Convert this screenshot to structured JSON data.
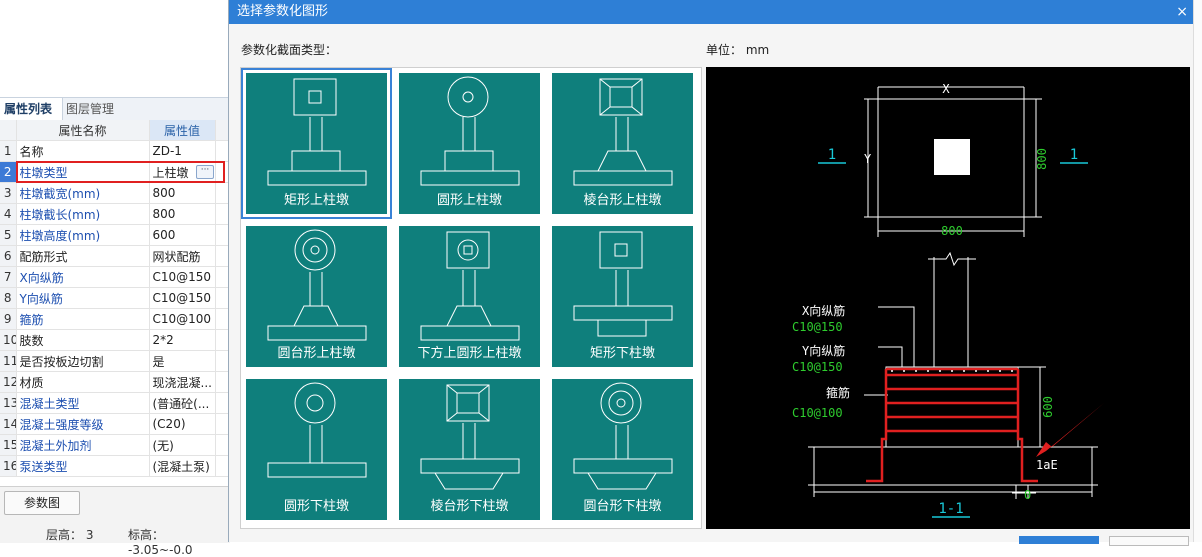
{
  "left_panel": {
    "tabs": [
      "属性列表",
      "图层管理"
    ],
    "table_headers": [
      "属性名称",
      "属性值"
    ],
    "rows": [
      {
        "n": "1",
        "name": "名称",
        "value": "ZD-1"
      },
      {
        "n": "2",
        "name": "柱墩类型",
        "value": "上柱墩"
      },
      {
        "n": "3",
        "name": "柱墩截宽(mm)",
        "value": "800"
      },
      {
        "n": "4",
        "name": "柱墩截长(mm)",
        "value": "800"
      },
      {
        "n": "5",
        "name": "柱墩高度(mm)",
        "value": "600"
      },
      {
        "n": "6",
        "name": "配筋形式",
        "value": "网状配筋"
      },
      {
        "n": "7",
        "name": "X向纵筋",
        "value": "C10@150"
      },
      {
        "n": "8",
        "name": "Y向纵筋",
        "value": "C10@150"
      },
      {
        "n": "9",
        "name": "箍筋",
        "value": "C10@100"
      },
      {
        "n": "10",
        "name": "肢数",
        "value": "2*2"
      },
      {
        "n": "11",
        "name": "是否按板边切割",
        "value": "是"
      },
      {
        "n": "12",
        "name": "材质",
        "value": "现浇混凝..."
      },
      {
        "n": "13",
        "name": "混凝土类型",
        "value": "(普通砼(..."
      },
      {
        "n": "14",
        "name": "混凝土强度等级",
        "value": "(C20)"
      },
      {
        "n": "15",
        "name": "混凝土外加剂",
        "value": "(无)"
      },
      {
        "n": "16",
        "name": "泵送类型",
        "value": "(混凝土泵)"
      }
    ],
    "dots_label": "···",
    "param_button": "参数图",
    "status_floor": "层高：  3",
    "status_elev": "标高：  -3.05~-0.0"
  },
  "dialog": {
    "title": "选择参数化图形",
    "close": "×",
    "type_label": "参数化截面类型：",
    "unit_label": "单位：  mm",
    "shapes": [
      "矩形上柱墩",
      "圆形上柱墩",
      "棱台形上柱墩",
      "圆台形上柱墩",
      "下方上圆形上柱墩",
      "矩形下柱墩",
      "圆形下柱墩",
      "棱台形下柱墩",
      "圆台形下柱墩"
    ],
    "preview": {
      "x_label": "X",
      "y_label": "Y",
      "section_mark": "1",
      "dim_width": "800",
      "dim_length": "800",
      "dim_height": "600",
      "x_bar_label": "X向纵筋",
      "x_bar_value": "C10@150",
      "y_bar_label": "Y向纵筋",
      "y_bar_value": "C10@150",
      "stirrup_label": "箍筋",
      "stirrup_value": "C10@100",
      "lae": "1aE",
      "zero": "0",
      "section_title": "1-1"
    }
  },
  "colors": {
    "tile": "#0f7f7c",
    "title_bar": "#2e7fd6",
    "rebar_red": "#e02020",
    "cad_green": "#2ecc2e",
    "cad_cyan": "#19c8d8"
  }
}
